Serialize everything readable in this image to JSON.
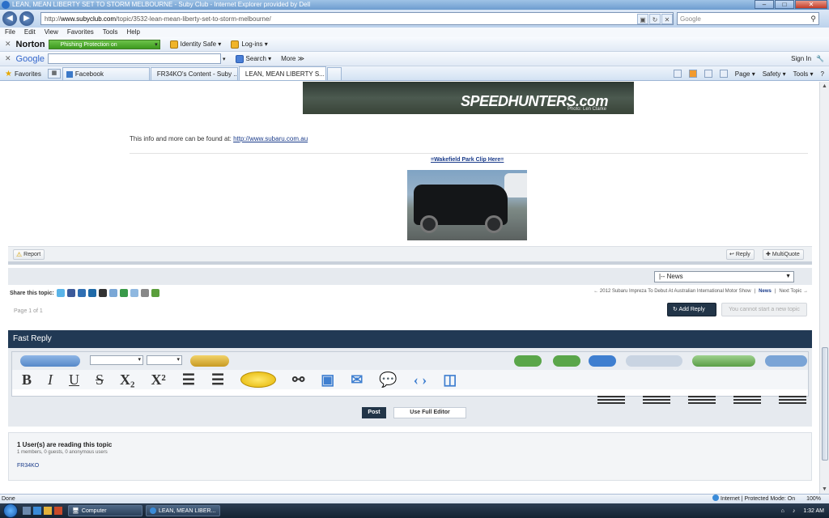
{
  "window": {
    "title": "LEAN, MEAN LIBERTY SET TO STORM MELBOURNE - Suby Club - Internet Explorer provided by Dell",
    "url_prefix": "http://",
    "url_host": "www.subyclub.com",
    "url_path": "/topic/3532-lean-mean-liberty-set-to-storm-melbourne/",
    "search_placeholder": "Google"
  },
  "menu": [
    "File",
    "Edit",
    "View",
    "Favorites",
    "Tools",
    "Help"
  ],
  "norton": {
    "logo": "Norton",
    "phishing": "Phishing Protection on",
    "identity": "Identity Safe ▾",
    "logins": "Log-ins ▾"
  },
  "google_toolbar": {
    "logo": "Google",
    "search": "Search ▾",
    "more": "More ≫",
    "signin": "Sign In"
  },
  "tabs": {
    "favorites": "Favorites",
    "items": [
      {
        "label": "Facebook"
      },
      {
        "label": "FR34KO's Content - Suby ..."
      },
      {
        "label": "LEAN, MEAN LIBERTY S..."
      }
    ],
    "commands": {
      "page": "Page ▾",
      "safety": "Safety ▾",
      "tools": "Tools ▾",
      "help": "?"
    }
  },
  "post": {
    "banner_text": "SPEEDHUNTERS.com",
    "banner_credit": "Photo: Len Clarke",
    "info_text": "This info and more can be found at:",
    "info_link": "http://www.subaru.com.au",
    "clip_link": "=Wakefield Park Clip Here=",
    "report": "Report",
    "reply": "Reply",
    "multiquote": "MultiQuote"
  },
  "topic_nav": {
    "forum_select": "|-- News",
    "share_label": "Share this topic:",
    "prev_topic": "← 2012 Subaru Impreza To Debut At Australian International Motor Show",
    "forum_link": "News",
    "next_topic": "Next Topic →",
    "page_of": "Page 1 of 1",
    "add_reply": "Add Reply",
    "cannot_start": "You cannot start a new topic"
  },
  "fast_reply": {
    "header": "Fast Reply",
    "post": "Post",
    "full_editor": "Use Full Editor"
  },
  "readers": {
    "title": "1 User(s) are reading this topic",
    "sub": "1 members, 0 guests, 0 anonymous users",
    "user": "FR34KO"
  },
  "status": {
    "left": "Done",
    "zone": "Internet | Protected Mode: On",
    "zoom": "100%"
  },
  "taskbar": {
    "computer": "Computer",
    "ie_task": "LEAN, MEAN LIBER...",
    "clock": "1:32 AM"
  }
}
